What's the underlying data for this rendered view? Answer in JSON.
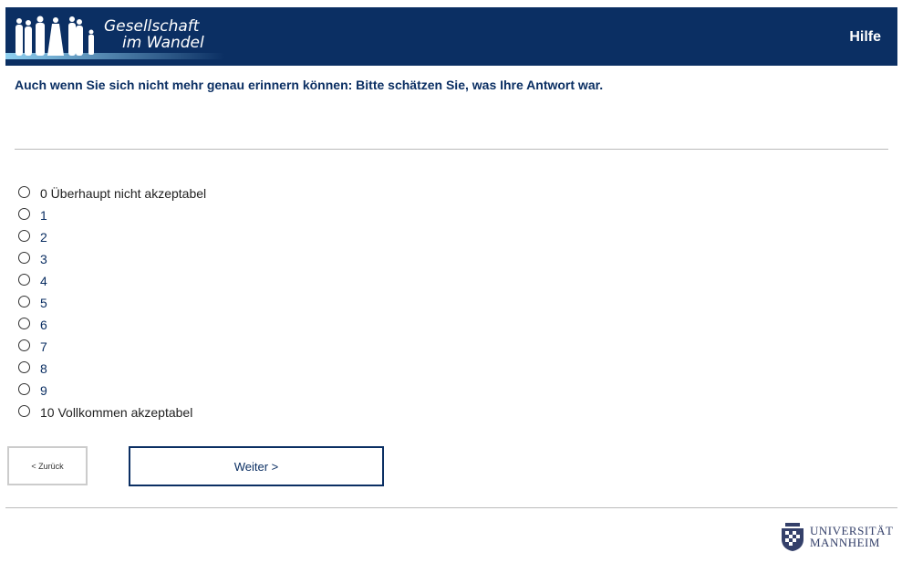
{
  "header": {
    "logo_line1": "Gesellschaft",
    "logo_line2": "im Wandel",
    "help_label": "Hilfe",
    "background": "#0b2f63"
  },
  "question": "Auch wenn Sie sich nicht mehr genau erinnern können: Bitte schätzen Sie, was Ihre Antwort war.",
  "options": [
    {
      "label": "0 Überhaupt nicht akzeptabel"
    },
    {
      "label": "1"
    },
    {
      "label": "2"
    },
    {
      "label": "3"
    },
    {
      "label": "4"
    },
    {
      "label": "5"
    },
    {
      "label": "6"
    },
    {
      "label": "7"
    },
    {
      "label": "8"
    },
    {
      "label": "9"
    },
    {
      "label": "10 Vollkommen akzeptabel"
    }
  ],
  "nav": {
    "back_label": "< Zurück",
    "next_label": "Weiter >"
  },
  "footer": {
    "uni_line1": "UNIVERSITÄT",
    "uni_line2": "MANNHEIM"
  }
}
